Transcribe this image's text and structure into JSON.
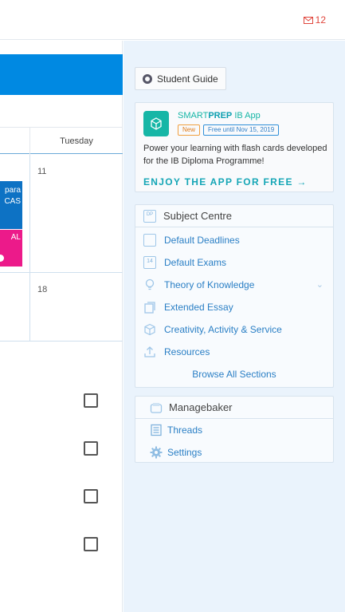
{
  "topbar": {
    "mail_count": "12"
  },
  "calendar": {
    "day_header": "Tuesday",
    "week1_day": "11",
    "week2_day": "18",
    "event_blue_line1": "para",
    "event_blue_line2": "CAS",
    "event_pink_text": "AL"
  },
  "sidebar": {
    "student_guide": "Student Guide",
    "promo": {
      "title_prefix": "SMART",
      "title_bold": "PREP",
      "title_suffix": " IB App",
      "badge_new": "New",
      "badge_free": "Free until Nov 15, 2019",
      "body": "Power your learning with flash cards developed for the IB Diploma Programme!",
      "cta": "ENJOY THE APP FOR FREE →"
    },
    "subject_centre": {
      "title": "Subject Centre",
      "items": [
        {
          "label": "Default Deadlines",
          "icon": "clipboard-check-icon"
        },
        {
          "label": "Default Exams",
          "icon": "calendar-icon",
          "icon_text": "14"
        },
        {
          "label": "Theory of Knowledge",
          "icon": "lightbulb-icon"
        },
        {
          "label": "Extended Essay",
          "icon": "document-stack-icon"
        },
        {
          "label": "Creativity, Activity & Service",
          "icon": "cube-icon"
        },
        {
          "label": "Resources",
          "icon": "upload-icon"
        }
      ],
      "browse": "Browse All Sections",
      "header_icon_text": "DP"
    },
    "managebaker": {
      "title": "Managebaker",
      "items": [
        {
          "label": "Threads",
          "icon": "threads-icon"
        },
        {
          "label": "Settings",
          "icon": "gear-icon"
        }
      ]
    }
  },
  "colors": {
    "accent_blue": "#0089e2",
    "teal": "#16b6a6",
    "pink": "#ec1a8a",
    "link": "#2a7fc5",
    "mail_red": "#e0463c"
  }
}
